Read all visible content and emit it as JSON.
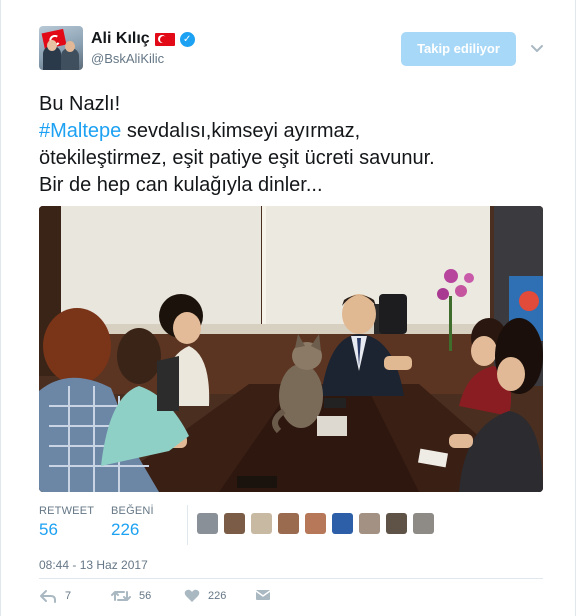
{
  "user": {
    "name": "Ali Kılıç",
    "handle": "@BskAliKilic",
    "avatar_icon": "profile-photo-with-flag",
    "country_flag_icon": "turkey-flag-icon",
    "verified_icon": "verified-badge-icon"
  },
  "follow_button": {
    "label": "Takip ediliyor"
  },
  "menu": {
    "icon": "chevron-down-icon"
  },
  "tweet": {
    "line1": "Bu Nazlı!",
    "hashtag": "#Maltepe",
    "line2_rest": " sevdalısı,kimseyi ayırmaz,",
    "line3": "ötekileştirmez, eşit patiye eşit ücreti savunur.",
    "line4": "Bir de hep can kulağıyla dinler..."
  },
  "stats": {
    "retweet_label": "RETWEET",
    "retweet_count": "56",
    "like_label": "BEĞENİ",
    "like_count": "226"
  },
  "likers": [
    "#8a9097",
    "#7a5c47",
    "#c8b9a3",
    "#9b6b50",
    "#b7785a",
    "#2c5fa8",
    "#a39184",
    "#5f5348",
    "#8e8a86"
  ],
  "timestamp": "08:44 - 13 Haz 2017",
  "actions": {
    "reply_count": "7",
    "retweet_count": "56",
    "like_count": "226"
  },
  "colors": {
    "accent": "#1da1f2",
    "follow_button_bg": "#a8d8f7",
    "muted": "#657786"
  }
}
